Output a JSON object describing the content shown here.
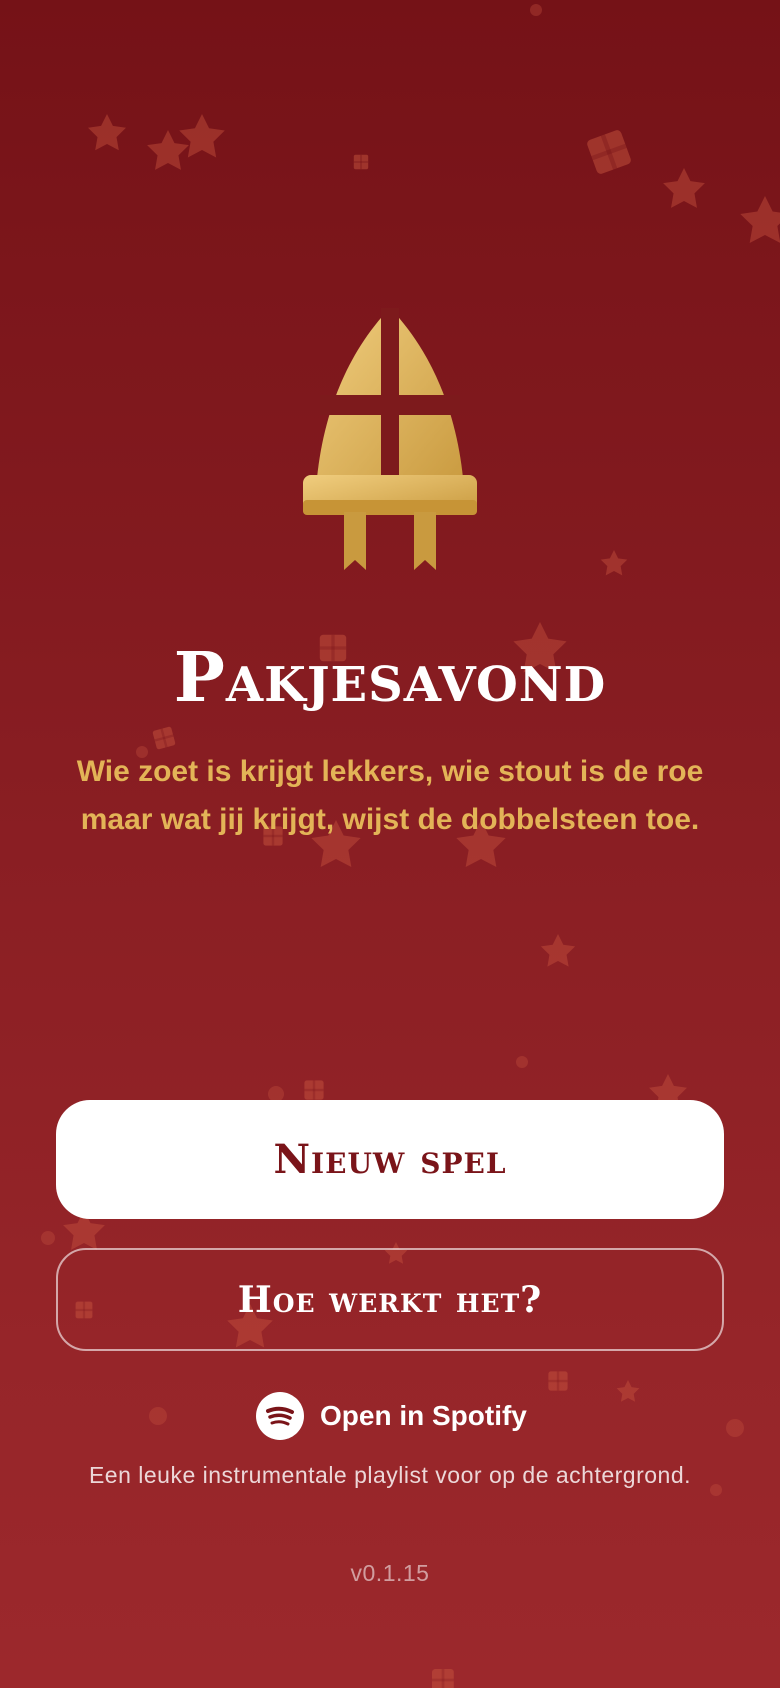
{
  "app": {
    "title": "Pakjesavond",
    "tagline": "Wie zoet is krijgt lekkers, wie stout is de roe maar wat jij krijgt, wijst de dobbelsteen toe."
  },
  "buttons": {
    "new_game": "Nieuw spel",
    "how_it_works": "Hoe werkt het?"
  },
  "spotify": {
    "icon": "spotify-icon",
    "label": "Open in Spotify",
    "note": "Een leuke instrumentale playlist voor op de achtergrond."
  },
  "version": "v0.1.15",
  "colors": {
    "background_top": "#751217",
    "background_bottom": "#9c282c",
    "gold": "#e3b457",
    "primary_button_text": "#7a1419"
  },
  "icons": {
    "logo": "mitre-icon",
    "background": [
      "star-icon",
      "gift-icon"
    ]
  }
}
